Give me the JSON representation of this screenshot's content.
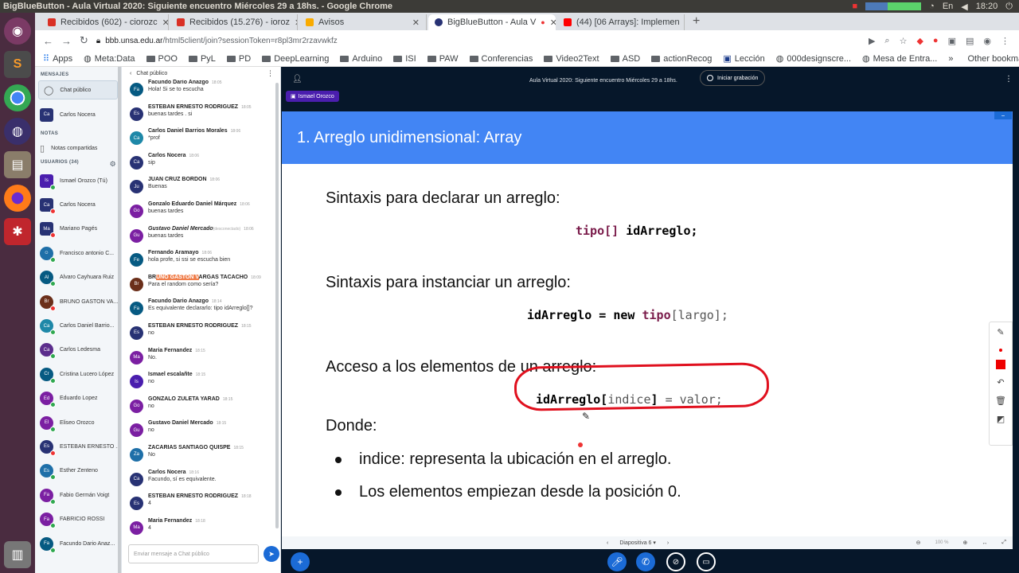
{
  "os": {
    "window_title": "BigBlueButton - Aula Virtual 2020: Siguiente encuentro Miércoles 29 a 18hs. - Google Chrome",
    "lang": "En",
    "clock": "18:20"
  },
  "tabs": [
    {
      "label": "Recibidos (602) - ciorozc",
      "color": "#d93025"
    },
    {
      "label": "Recibidos (15.276) - ioroz",
      "color": "#d93025"
    },
    {
      "label": "Avisos",
      "color": "#f9ab00"
    },
    {
      "label": "BigBlueButton - Aula V",
      "color": "#283274"
    },
    {
      "label": "(44) [06 Arrays]: Implemen",
      "color": "#ff0000"
    }
  ],
  "address": {
    "host": "bbb.unsa.edu.ar",
    "path": "/html5client/join?sessionToken=r8pl3mr2rzavwkfz"
  },
  "bookmarks": [
    "Apps",
    "Meta:Data",
    "POO",
    "PyL",
    "PD",
    "DeepLearning",
    "Arduino",
    "ISI",
    "PAW",
    "Conferencias",
    "Video2Text",
    "ASD",
    "actionRecog",
    "Lección",
    "000designscre...",
    "Mesa de Entra..."
  ],
  "bookmarks_more": "»",
  "other_bookmarks": "Other bookmarks",
  "userlist": {
    "messages_heading": "MENSAJES",
    "public_chat": "Chat público",
    "private_chat_user": {
      "initials": "Ca",
      "name": "Carlos Nocera"
    },
    "notes_heading": "NOTAS",
    "shared_notes": "Notas compartidas",
    "users_heading": "USUARIOS (34)",
    "users": [
      {
        "initials": "Is",
        "name": "Ismael Orozco (Tú)",
        "color": "#4a1eae",
        "dot": "#2fa84f",
        "round": false
      },
      {
        "initials": "Ca",
        "name": "Carlos Nocera",
        "color": "#283274",
        "dot": "#e33",
        "round": false
      },
      {
        "initials": "Ma",
        "name": "Mariano Pagés",
        "color": "#283274",
        "dot": "#e33",
        "round": false
      },
      {
        "initials": "☺",
        "name": "Francisco antonio C...",
        "color": "#1e6fa8",
        "dot": "#2fa84f",
        "round": true
      },
      {
        "initials": "Al",
        "name": "Alvaro Cayhuara Ruiz",
        "color": "#065a82",
        "dot": "#2fa84f",
        "round": true
      },
      {
        "initials": "Br",
        "name": "BRUNO GASTON VA...",
        "color": "#6b2f1a",
        "dot": "#e33",
        "round": true
      },
      {
        "initials": "Ca",
        "name": "Carlos Daniel Barrio...",
        "color": "#1e88a8",
        "dot": "#2fa84f",
        "round": true
      },
      {
        "initials": "Ca",
        "name": "Carlos Ledesma",
        "color": "#5b2d8c",
        "dot": "#2fa84f",
        "round": true
      },
      {
        "initials": "Cr",
        "name": "Cristina Lucero López",
        "color": "#065a82",
        "dot": "#2fa84f",
        "round": true
      },
      {
        "initials": "Ed",
        "name": "Eduardo Lopez",
        "color": "#7b1fa2",
        "dot": "#2fa84f",
        "round": true
      },
      {
        "initials": "El",
        "name": "Eliseo Orozco",
        "color": "#7b1fa2",
        "dot": "#2fa84f",
        "round": true
      },
      {
        "initials": "Es",
        "name": "ESTEBAN ERNESTO ...",
        "color": "#283274",
        "dot": "#e33",
        "round": true
      },
      {
        "initials": "Es",
        "name": "Esther Zenteno",
        "color": "#1e6fa8",
        "dot": "#2fa84f",
        "round": true
      },
      {
        "initials": "Fa",
        "name": "Fabio Germán Voigt",
        "color": "#7b1fa2",
        "dot": "#2fa84f",
        "round": true
      },
      {
        "initials": "Fa",
        "name": "FABRICIO ROSSI",
        "color": "#7b1fa2",
        "dot": "#2fa84f",
        "round": true
      },
      {
        "initials": "Fa",
        "name": "Facundo Dario Anaz...",
        "color": "#065a82",
        "dot": "#2fa84f",
        "round": true
      }
    ]
  },
  "chat": {
    "title": "Chat público",
    "messages": [
      {
        "initials": "Fa",
        "name": "Facundo Dario Anazgo",
        "time": "18:05",
        "text": "Hola! Si se to escucha",
        "color": "#065a82",
        "status": ""
      },
      {
        "initials": "Es",
        "name": "ESTEBAN ERNESTO RODRIGUEZ",
        "time": "18:05",
        "text": "buenas tardes . si",
        "color": "#283274",
        "status": ""
      },
      {
        "initials": "Ca",
        "name": "Carlos Daniel Barrios Morales",
        "time": "18:06",
        "text": "*prof",
        "color": "#1e88a8",
        "status": ""
      },
      {
        "initials": "Ca",
        "name": "Carlos Nocera",
        "time": "18:06",
        "text": "sip",
        "color": "#283274",
        "status": ""
      },
      {
        "initials": "Ju",
        "name": "JUAN CRUZ BORDON",
        "time": "18:06",
        "text": "Buenas",
        "color": "#283274",
        "status": ""
      },
      {
        "initials": "Go",
        "name": "Gonzalo Eduardo Daniel Márquez",
        "time": "18:06",
        "text": "buenas tardes",
        "color": "#7b1fa2",
        "status": ""
      },
      {
        "initials": "Gu",
        "name": "Gustavo Daniel Mercado",
        "time": "18:06",
        "text": "buenas tardes",
        "color": "#7b1fa2",
        "status": "(desconectado)"
      },
      {
        "initials": "Fe",
        "name": "Fernando Aramayo",
        "time": "18:06",
        "text": "hola profe, si ssi se escucha bien",
        "color": "#065a82",
        "status": ""
      },
      {
        "initials": "Br",
        "name_pre": "BR",
        "name_hl": "UNO GASTON V",
        "name_post": "ARGAS TACACHO",
        "time": "18:09",
        "text": "Para el random como sería?",
        "color": "#6b2f1a",
        "status": ""
      },
      {
        "initials": "Fa",
        "name": "Facundo Dario Anazgo",
        "time": "18:14",
        "text": "Es equivalente declararlo: tipo idArreglo[]?",
        "color": "#065a82",
        "status": ""
      },
      {
        "initials": "Es",
        "name": "ESTEBAN ERNESTO RODRIGUEZ",
        "time": "18:15",
        "text": "no",
        "color": "#283274",
        "status": ""
      },
      {
        "initials": "Ma",
        "name": "Maria Fernandez",
        "time": "18:15",
        "text": "No.",
        "color": "#7b1fa2",
        "status": ""
      },
      {
        "initials": "Is",
        "name": "Ismael escalañte",
        "time": "18:15",
        "text": "no",
        "color": "#4a1eae",
        "status": ""
      },
      {
        "initials": "Go",
        "name": "GONZALO ZULETA YARAD",
        "time": "18:15",
        "text": "no",
        "color": "#7b1fa2",
        "status": ""
      },
      {
        "initials": "Gu",
        "name": "Gustavo Daniel Mercado",
        "time": "18:15",
        "text": "no",
        "color": "#7b1fa2",
        "status": ""
      },
      {
        "initials": "Za",
        "name": "ZACARIAS SANTIAGO QUISPE",
        "time": "18:15",
        "text": "No",
        "color": "#1e6fa8",
        "status": ""
      },
      {
        "initials": "Ca",
        "name": "Carlos Nocera",
        "time": "18:16",
        "text": "Facundo, sí es equivalente.",
        "color": "#283274",
        "status": ""
      },
      {
        "initials": "Es",
        "name": "ESTEBAN ERNESTO RODRIGUEZ",
        "time": "18:18",
        "text": "4",
        "color": "#283274",
        "status": ""
      },
      {
        "initials": "Ma",
        "name": "Maria Fernandez",
        "time": "18:18",
        "text": "4",
        "color": "#7b1fa2",
        "status": ""
      }
    ],
    "input_placeholder": "Enviar mensaje a Chat público"
  },
  "meeting": {
    "title": "Aula Virtual 2020: Siguiente encuentro Miércoles 29 a 18hs.",
    "record_label": "Iniciar grabación",
    "presenter": "Ismael Orozco"
  },
  "slide": {
    "heading": "1. Arreglo unidimensional: Array",
    "l1": "Sintaxis para declarar un arreglo:",
    "c1_type": "tipo[]",
    "c1_rest": " idArreglo;",
    "l2": "Sintaxis para instanciar un arreglo:",
    "c2_a": "idArreglo = ",
    "c2_new": "new",
    "c2_sp": " ",
    "c2_type": "tipo",
    "c2_rest": "[largo];",
    "l3": "Acceso a los elementos de un arreglo:",
    "c3_a": "idArreglo[",
    "c3_b": "indice",
    "c3_c": "] ",
    "c3_d": "= valor;",
    "l4": "Donde:",
    "b1": "indice: representa la ubicación en el arreglo.",
    "b2": "Los elementos empiezan desde la posición 0."
  },
  "slide_nav": {
    "label": "Diapositiva 6",
    "zoom": "100 %"
  }
}
